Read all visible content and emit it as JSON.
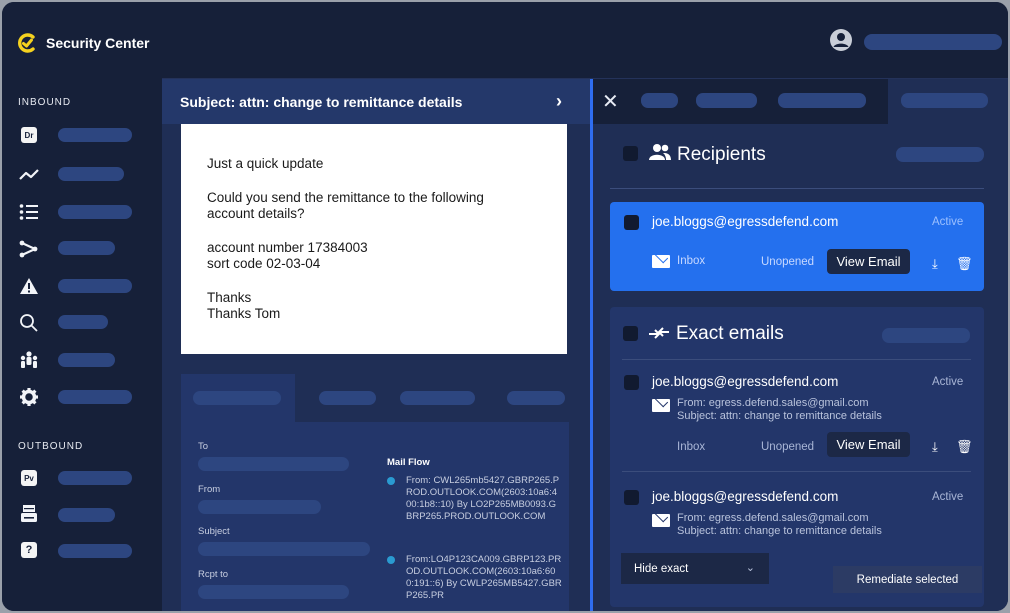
{
  "app": {
    "title": "Security Center"
  },
  "sidebar": {
    "inbound_label": "INBOUND",
    "outbound_label": "OUTBOUND",
    "inbound_items": [
      {
        "icon": "dr-badge-icon",
        "glyph": "Dr"
      },
      {
        "icon": "trend-line-icon",
        "glyph": "〜"
      },
      {
        "icon": "list-icon",
        "glyph": "☰"
      },
      {
        "icon": "share-nodes-icon",
        "glyph": "⪥"
      },
      {
        "icon": "warning-icon",
        "glyph": "⚠"
      },
      {
        "icon": "search-icon",
        "glyph": "⌕"
      },
      {
        "icon": "people-icon",
        "glyph": "⚇"
      },
      {
        "icon": "gear-icon",
        "glyph": "⚙"
      }
    ],
    "outbound_items": [
      {
        "icon": "pv-badge-icon",
        "glyph": "Pv"
      },
      {
        "icon": "printer-icon",
        "glyph": "⎙"
      },
      {
        "icon": "help-icon",
        "glyph": "?"
      }
    ]
  },
  "email": {
    "subject": "Subject: attn: change to remittance details",
    "body": [
      "Just a quick update",
      "Could you send the remittance to the following\naccount details?",
      "account number 17384003\nsort code 02-03-04",
      "Thanks\nThanks Tom"
    ],
    "details": {
      "to_label": "To",
      "from_label": "From",
      "subject_label": "Subject",
      "rcpt_label": "Rcpt to",
      "mail_flow_title": "Mail Flow",
      "mail_flow": [
        "From: CWL265mb5427.GBRP265.PROD.OUTLOOK.COM(2603:10a6:400:1b8::10) By LO2P265MB0093.GBRP265.PROD.OUTLOOK.COM",
        "From:LO4P123CA009.GBRP123.PROD.OUTLOOK.COM(2603:10a6:600:191::6) By CWLP265MB5427.GBRP265.PR"
      ]
    }
  },
  "recipients": {
    "title": "Recipients",
    "card": {
      "email": "joe.bloggs@egressdefend.com",
      "status": "Active",
      "folder": "Inbox",
      "read_state": "Unopened",
      "view_label": "View Email"
    }
  },
  "exact_emails": {
    "title": "Exact emails",
    "items": [
      {
        "email": "joe.bloggs@egressdefend.com",
        "status": "Active",
        "from": "From: egress.defend.sales@gmail.com",
        "subject": "Subject: attn: change to remittance details",
        "folder": "Inbox",
        "read_state": "Unopened",
        "view_label": "View Email"
      },
      {
        "email": "joe.bloggs@egressdefend.com",
        "status": "Active",
        "from": "From: egress.defend.sales@gmail.com",
        "subject": "Subject: attn: change to remittance details"
      }
    ],
    "hide_label": "Hide exact",
    "remediate_label": "Remediate selected"
  },
  "colors": {
    "accent": "#2470ee",
    "logo_yellow": "#f5d21f",
    "flow_dot": "#2a9bd1"
  }
}
